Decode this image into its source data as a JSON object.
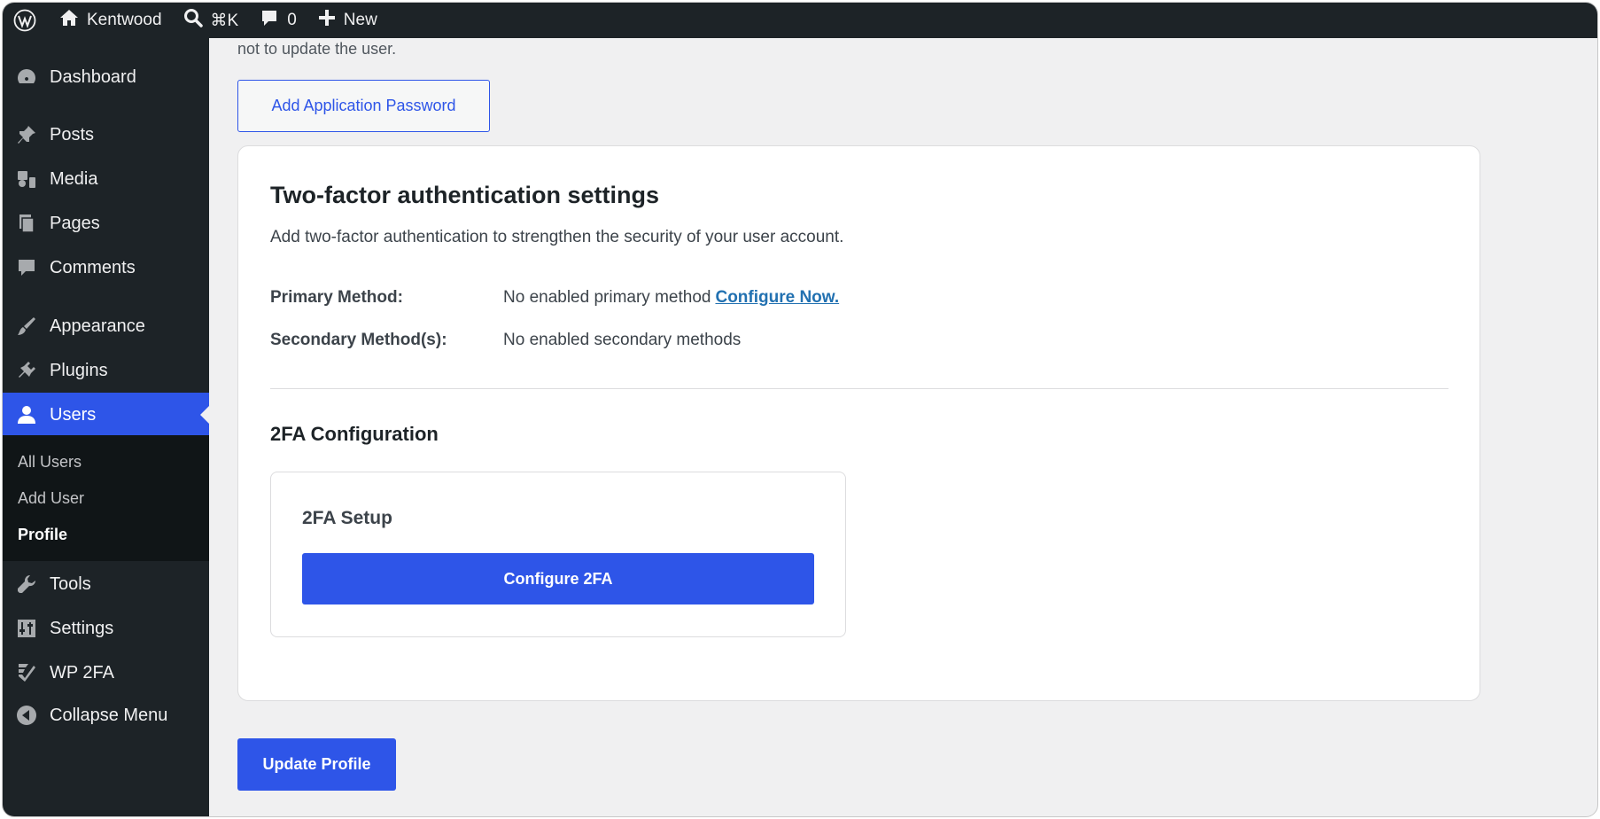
{
  "adminbar": {
    "site_name": "Kentwood",
    "search_shortcut": "⌘K",
    "comments_count": "0",
    "new_label": "New"
  },
  "sidebar": {
    "items": [
      {
        "label": "Dashboard",
        "icon": "dashboard-icon"
      },
      {
        "label": "Posts",
        "icon": "pin-icon"
      },
      {
        "label": "Media",
        "icon": "media-icon"
      },
      {
        "label": "Pages",
        "icon": "pages-icon"
      },
      {
        "label": "Comments",
        "icon": "comment-icon"
      },
      {
        "label": "Appearance",
        "icon": "brush-icon"
      },
      {
        "label": "Plugins",
        "icon": "plugin-icon"
      },
      {
        "label": "Users",
        "icon": "user-icon"
      },
      {
        "label": "Tools",
        "icon": "wrench-icon"
      },
      {
        "label": "Settings",
        "icon": "settings-icon"
      },
      {
        "label": "WP 2FA",
        "icon": "wp2fa-icon"
      },
      {
        "label": "Collapse Menu",
        "icon": "collapse-icon"
      }
    ],
    "submenu": [
      "All Users",
      "Add User",
      "Profile"
    ],
    "active": "Users",
    "current_sub": "Profile"
  },
  "content": {
    "cut_text": "not to update the user.",
    "add_app_password": "Add Application Password",
    "twofa": {
      "title": "Two-factor authentication settings",
      "description": "Add two-factor authentication to strengthen the security of your user account.",
      "primary_label": "Primary Method:",
      "primary_value": "No enabled primary method",
      "primary_link": "Configure Now.",
      "secondary_label": "Secondary Method(s):",
      "secondary_value": "No enabled secondary methods",
      "config_title": "2FA Configuration",
      "setup_title": "2FA Setup",
      "configure_button": "Configure 2FA"
    },
    "update_button": "Update Profile"
  },
  "colors": {
    "accent": "#2e55e8",
    "sidebar_bg": "#1d2327",
    "link": "#2271b1"
  }
}
